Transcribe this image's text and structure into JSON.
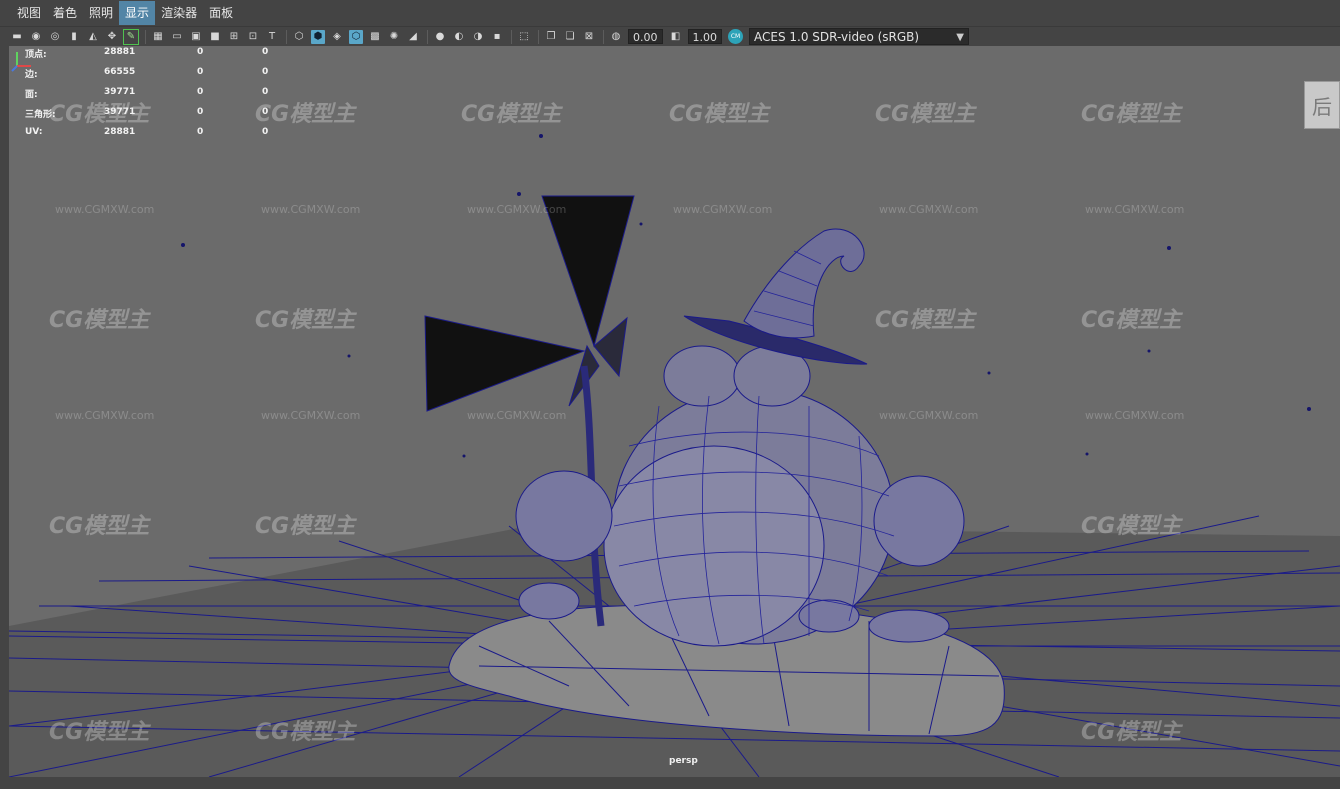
{
  "menubar": {
    "items": [
      {
        "label": "视图"
      },
      {
        "label": "着色"
      },
      {
        "label": "照明"
      },
      {
        "label": "显示"
      },
      {
        "label": "渲染器"
      },
      {
        "label": "面板"
      }
    ],
    "active_index": 3
  },
  "toolbar": {
    "exposure_value": "0.00",
    "gamma_value": "1.00",
    "color_space": "ACES 1.0 SDR-video (sRGB)",
    "icons": [
      "camera-icon",
      "camera-lock-icon",
      "camera-attributes-icon",
      "bookmark-icon",
      "image-plane-icon",
      "2d-pan-zoom-icon",
      "grease-pencil-icon",
      "grid-icon",
      "film-gate-icon",
      "resolution-gate-icon",
      "gate-mask-icon",
      "field-chart-icon",
      "safe-action-icon",
      "safe-title-icon",
      "wireframe-icon",
      "smooth-shade-icon",
      "default-material-icon",
      "wireframe-on-shaded-icon",
      "xray-icon",
      "use-lights-icon",
      "shadows-icon",
      "ambient-occlusion-icon",
      "motion-blur-icon",
      "isolate-select-icon",
      "xray-joints-icon",
      "xray-active-icon",
      "backface-culling-icon",
      "exposure-icon",
      "gamma-icon",
      "color-management-icon"
    ]
  },
  "hud": {
    "rows": [
      {
        "label": "顶点:",
        "v1": "28881",
        "v2": "0",
        "v3": "0"
      },
      {
        "label": "边:",
        "v1": "66555",
        "v2": "0",
        "v3": "0"
      },
      {
        "label": "面:",
        "v1": "39771",
        "v2": "0",
        "v3": "0"
      },
      {
        "label": "三角形:",
        "v1": "39771",
        "v2": "0",
        "v3": "0"
      },
      {
        "label": "UV:",
        "v1": "28881",
        "v2": "0",
        "v3": "0"
      }
    ]
  },
  "viewport": {
    "camera": "persp",
    "view_cube_label": "后",
    "wireframe_color": "#1a1a8a",
    "background_color": "#6b6b6b"
  },
  "watermark": {
    "logo_text": "CG模型主",
    "url_text": "www.CGMXW.com"
  }
}
